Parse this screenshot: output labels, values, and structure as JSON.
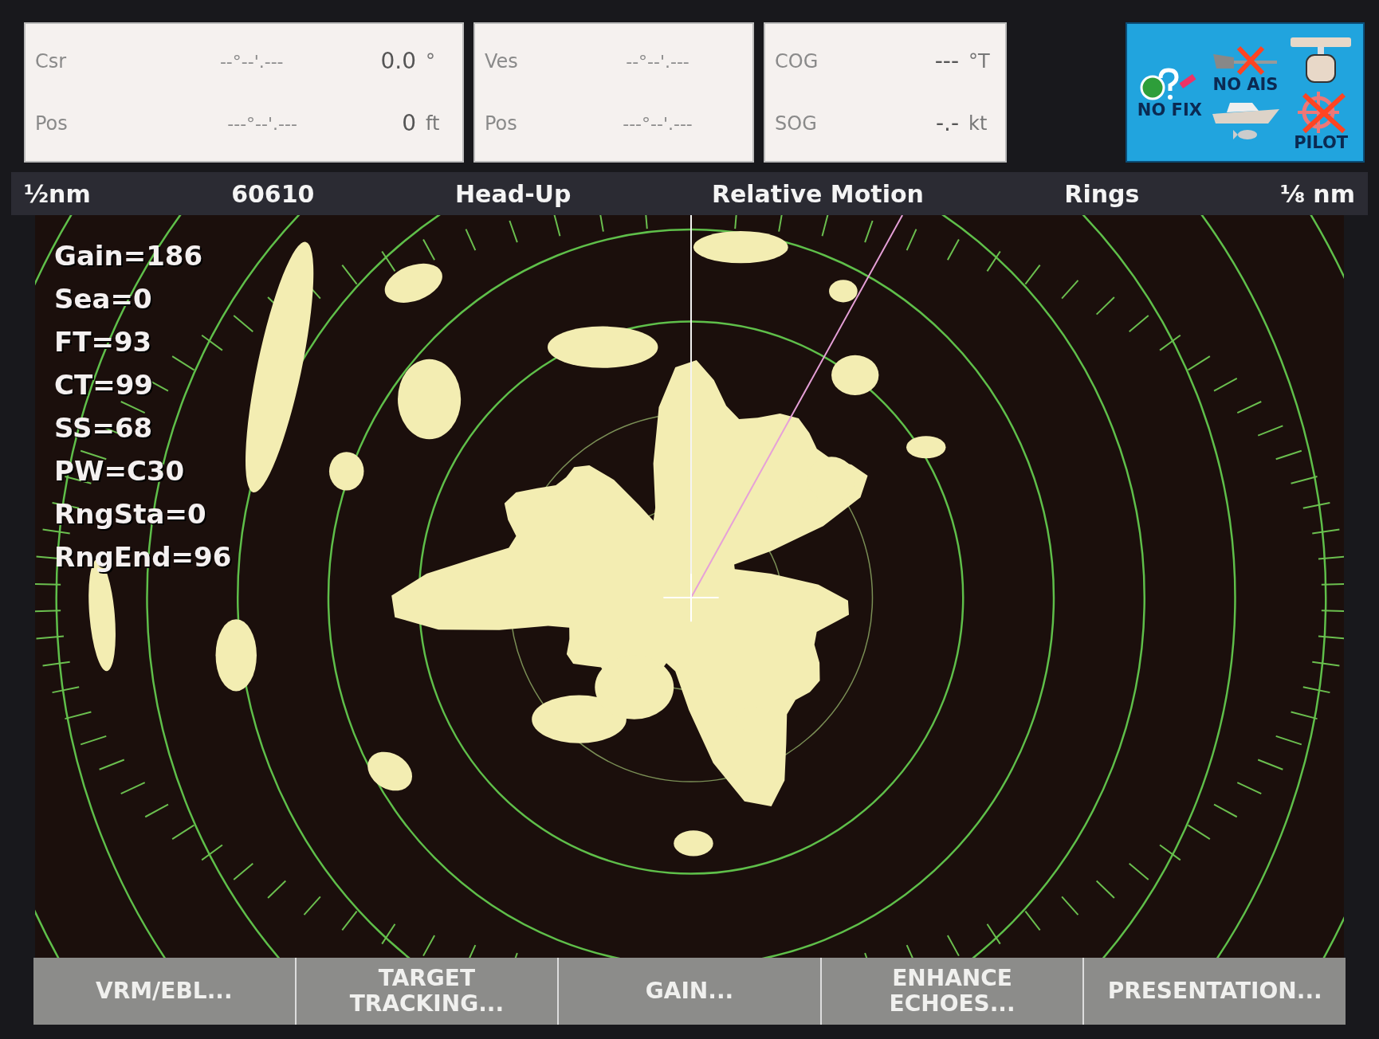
{
  "position_panels": [
    {
      "rows": [
        {
          "label": "Csr",
          "coordinate": "--°--'.---",
          "value": "0.0",
          "unit": "°"
        },
        {
          "label": "Pos",
          "coordinate": "---°--'.---",
          "value": "0",
          "unit": "ft"
        }
      ]
    },
    {
      "rows": [
        {
          "label": "Ves",
          "coordinate": "--°--'.---"
        },
        {
          "label": "Pos",
          "coordinate": "---°--'.---"
        }
      ]
    },
    {
      "rows": [
        {
          "label": "COG",
          "value": "---",
          "unit": "°T"
        },
        {
          "label": "SOG",
          "value": "-.-",
          "unit": "kt"
        }
      ]
    }
  ],
  "status_columns": [
    [
      {
        "kind": "gps",
        "label": "NO FIX"
      }
    ],
    [
      {
        "kind": "ais",
        "label": "NO AIS"
      },
      {
        "kind": "vessel"
      },
      {
        "kind": "fish"
      }
    ],
    [
      {
        "kind": "radar"
      },
      {
        "kind": "autopilot",
        "label": "PILOT"
      }
    ]
  ],
  "header": [
    "½nm",
    "60610",
    "Head-Up",
    "Relative Motion",
    "Rings",
    "⅛ nm"
  ],
  "radar_settings": [
    "Gain=186",
    "Sea=0",
    "FT=93",
    "CT=99",
    "SS=68",
    "PW=C30",
    "RngSta=0",
    "RngEnd=96"
  ],
  "softkeys": [
    {
      "lines": [
        "VRM/EBL..."
      ]
    },
    {
      "lines": [
        "TARGET",
        "TRACKING..."
      ]
    },
    {
      "lines": [
        "GAIN..."
      ]
    },
    {
      "lines": [
        "ENHANCE",
        "ECHOES..."
      ]
    },
    {
      "lines": [
        "PRESENTATION..."
      ]
    }
  ]
}
